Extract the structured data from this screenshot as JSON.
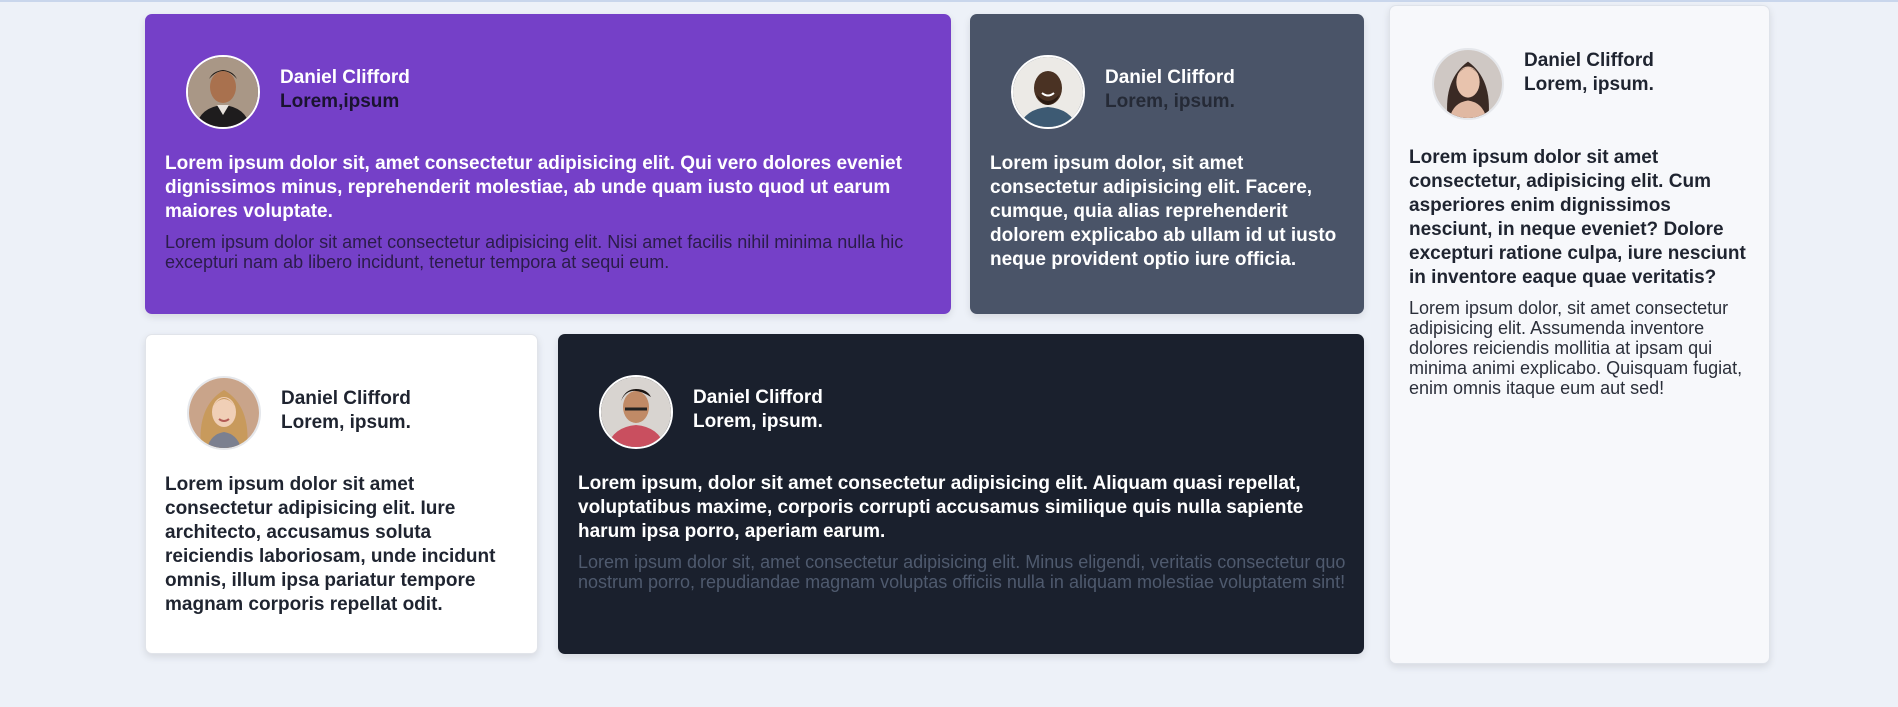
{
  "cards": [
    {
      "name": "Daniel Clifford",
      "role": "Lorem,ipsum",
      "quote": "Lorem ipsum dolor sit, amet consectetur adipisicing elit. Qui vero dolores eveniet dignissimos minus, reprehenderit molestiae, ab unde quam iusto quod ut earum maiores voluptate.",
      "text": "Lorem ipsum dolor sit amet consectetur adipisicing elit. Nisi amet facilis nihil minima nulla hic excepturi nam ab libero incidunt, tenetur tempora at sequi eum."
    },
    {
      "name": "Daniel Clifford",
      "role": "Lorem, ipsum.",
      "quote": "Lorem ipsum dolor, sit amet consectetur adipisicing elit. Facere, cumque, quia alias reprehenderit dolorem explicabo ab ullam id ut iusto neque provident optio iure officia."
    },
    {
      "name": "Daniel Clifford",
      "role": "Lorem, ipsum.",
      "quote": "Lorem ipsum dolor sit amet consectetur, adipisicing elit. Cum asperiores enim dignissimos nesciunt, in neque eveniet? Dolore excepturi ratione culpa, iure nesciunt in inventore eaque quae veritatis?",
      "text": "Lorem ipsum dolor, sit amet consectetur adipisicing elit. Assumenda inventore dolores reiciendis mollitia at ipsam qui minima animi explicabo. Quisquam fugiat, enim omnis itaque eum aut sed!"
    },
    {
      "name": "Daniel Clifford",
      "role": "Lorem, ipsum.",
      "quote": "Lorem ipsum dolor sit amet consectetur adipisicing elit. Iure architecto, accusamus soluta reiciendis laboriosam, unde incidunt omnis, illum ipsa pariatur tempore magnam corporis repellat odit."
    },
    {
      "name": "Daniel Clifford",
      "role": "Lorem, ipsum.",
      "quote": "Lorem ipsum, dolor sit amet consectetur adipisicing elit. Aliquam quasi repellat, voluptatibus maxime, corporis corrupti accusamus similique quis nulla sapiente harum ipsa porro, aperiam earum.",
      "text": "Lorem ipsum dolor sit, amet consectetur adipisicing elit. Minus eligendi, veritatis consectetur quo nostrum porro, repudiandae magnam voluptas officiis nulla in aliquam molestiae voluptatem sint!"
    }
  ],
  "colors": {
    "page_bg": "#edf1f8",
    "purple": "#7540c8",
    "slate": "#4a5468",
    "light": "#f7f8fb",
    "white": "#ffffff",
    "dark": "#1a202d"
  },
  "icons": [
    "avatar-photo"
  ]
}
